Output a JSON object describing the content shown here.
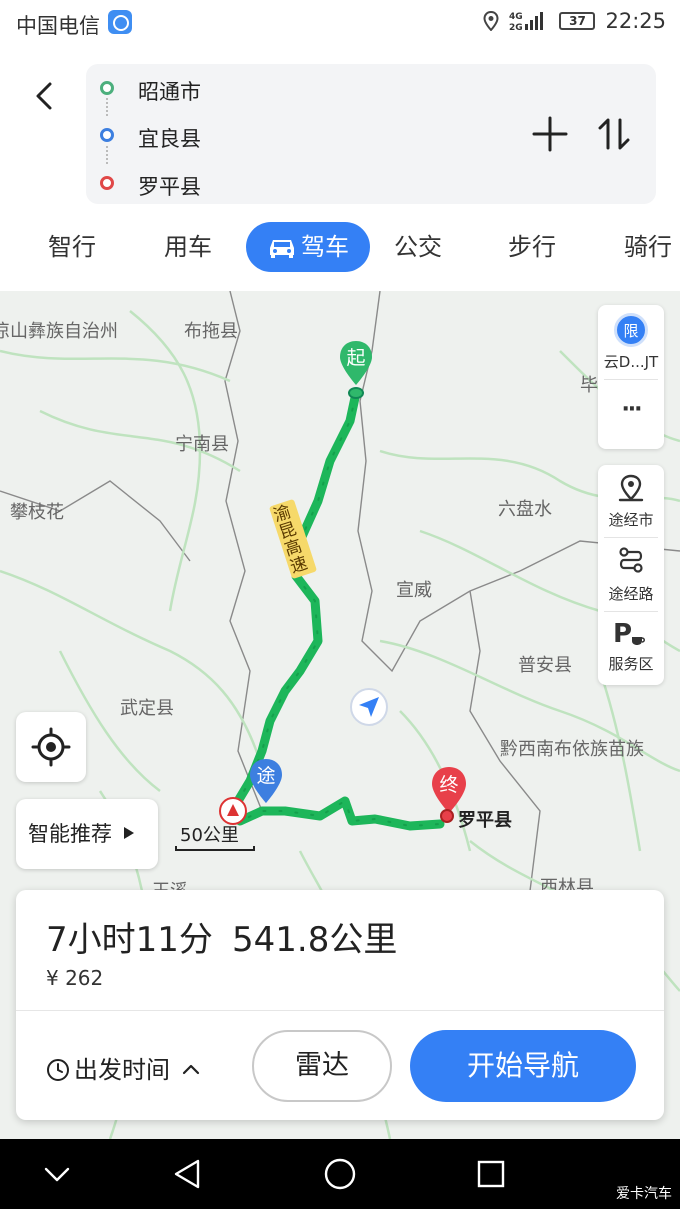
{
  "status": {
    "carrier": "中国电信",
    "network": "4G 2G",
    "battery": "37",
    "time": "22:25"
  },
  "route": {
    "stops": [
      {
        "name": "昭通市",
        "color": "#4caf7d"
      },
      {
        "name": "宜良县",
        "color": "#3d7fe0"
      },
      {
        "name": "罗平县",
        "color": "#e04848"
      }
    ]
  },
  "tabs": [
    {
      "label": "智行",
      "active": false
    },
    {
      "label": "用车",
      "active": false
    },
    {
      "label": "驾车",
      "active": true
    },
    {
      "label": "公交",
      "active": false
    },
    {
      "label": "步行",
      "active": false
    },
    {
      "label": "骑行",
      "active": false
    }
  ],
  "map": {
    "labels": [
      "凉山彝族自治州",
      "布拖县",
      "宁南县",
      "攀枝花",
      "六盘水",
      "宣威",
      "普安县",
      "武定县",
      "黔西南布依族苗族",
      "西林县",
      "玉溪",
      "罗平县",
      "毕"
    ],
    "road_name": "渝昆高速",
    "markers": {
      "start": "起",
      "via": "途",
      "end": "终"
    },
    "scale": "50公里",
    "route_color": "#1db65a"
  },
  "side_panel": {
    "restriction": "限",
    "restriction_label": "云D...JT",
    "more": "···",
    "via_city": "途经市",
    "via_road": "途经路",
    "service_area": "服务区"
  },
  "smart_button": "智能推荐",
  "summary": {
    "duration": "7小时11分",
    "distance": "541.8公里",
    "fee": "¥ 262",
    "depart_time": "出发时间",
    "radar": "雷达",
    "start_nav": "开始导航"
  },
  "watermark": "爱卡汽车",
  "accent": "#3480f5"
}
